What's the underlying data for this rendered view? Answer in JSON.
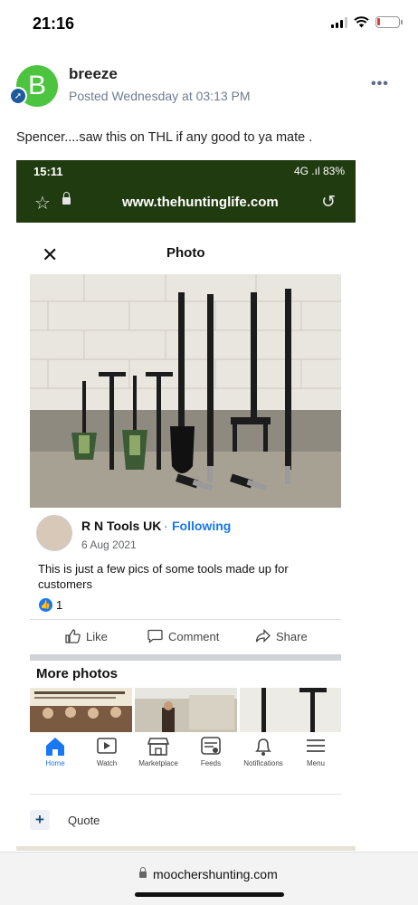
{
  "status_bar": {
    "time": "21:16",
    "battery_color": "#e53935",
    "battery_level": 0.12
  },
  "post": {
    "avatar_letter": "B",
    "avatar_color": "#4cc43f",
    "author": "breeze",
    "posted": "Posted Wednesday at 03:13 PM",
    "more_icon": "ellipsis-icon",
    "text": "Spencer....saw this on THL if any good to ya mate ."
  },
  "embedded": {
    "browser": {
      "time": "15:11",
      "status": "4G .ıl 83%",
      "url": "www.thehuntinglife.com",
      "accent": "#203b0f"
    },
    "photo_viewer": {
      "title": "Photo"
    },
    "fb_post": {
      "name": "R N Tools UK",
      "separator": "·",
      "follow_status": "Following",
      "date": "6 Aug 2021",
      "caption": "This is just a few pics of some tools made up for customers",
      "like_count": "1",
      "actions": {
        "like": "Like",
        "comment": "Comment",
        "share": "Share"
      },
      "more_photos": "More photos",
      "nav": [
        "Home",
        "Watch",
        "Marketplace",
        "Feeds",
        "Notifications",
        "Menu"
      ],
      "brand_color": "#1877f2"
    }
  },
  "quote": {
    "label": "Quote"
  },
  "safari": {
    "url": "moochershunting.com"
  }
}
